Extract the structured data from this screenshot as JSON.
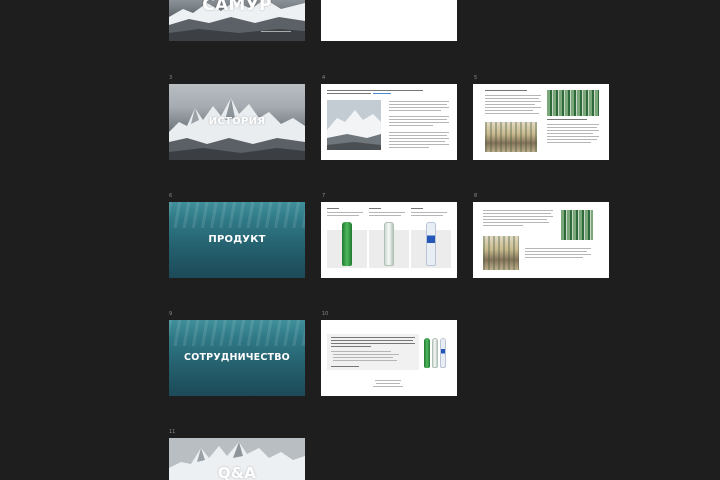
{
  "slides": {
    "s1": {
      "title": "САМУР"
    },
    "s3": {
      "num": "3",
      "title": "ИСТОРИЯ"
    },
    "s4": {
      "num": "4"
    },
    "s5": {
      "num": "5"
    },
    "s6": {
      "num": "6",
      "title": "ПРОДУКТ"
    },
    "s7": {
      "num": "7"
    },
    "s8": {
      "num": "8"
    },
    "s9": {
      "num": "9",
      "title": "СОТРУДНИЧЕСТВО"
    },
    "s10": {
      "num": "10"
    },
    "s11": {
      "num": "11",
      "title": "Q&A"
    }
  },
  "colors": {
    "background": "#1e1e1e",
    "slide_white": "#ffffff",
    "water": "#2f7886",
    "link": "#2f7fd0"
  }
}
